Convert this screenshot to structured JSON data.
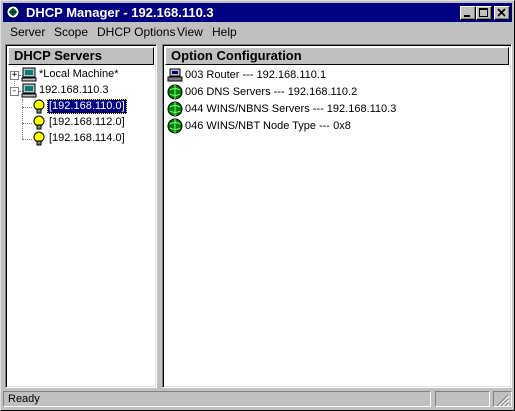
{
  "window": {
    "title": "DHCP Manager - 192.168.110.3"
  },
  "menu": [
    "Server",
    "Scope",
    "DHCP Options",
    "View",
    "Help"
  ],
  "left_panel": {
    "header": "DHCP Servers",
    "tree": [
      {
        "label": "*Local Machine*",
        "level": 0,
        "expander": "+",
        "icon": "server-icon"
      },
      {
        "label": "192.168.110.3",
        "level": 0,
        "expander": "-",
        "icon": "server-icon"
      },
      {
        "label": "[192.168.110.0]",
        "level": 1,
        "selected": true,
        "icon": "lightbulb-icon"
      },
      {
        "label": "[192.168.112.0]",
        "level": 1,
        "icon": "lightbulb-icon"
      },
      {
        "label": "[192.168.114.0]",
        "level": 1,
        "icon": "lightbulb-icon"
      }
    ]
  },
  "right_panel": {
    "header": "Option Configuration",
    "options": [
      {
        "text": "003 Router --- 192.168.110.1",
        "icon": "global-option-icon"
      },
      {
        "text": "006 DNS Servers --- 192.168.110.2",
        "icon": "scope-option-icon"
      },
      {
        "text": "044 WINS/NBNS Servers --- 192.168.110.3",
        "icon": "scope-option-icon"
      },
      {
        "text": "046 WINS/NBT Node Type --- 0x8",
        "icon": "scope-option-icon"
      }
    ]
  },
  "status": {
    "text": "Ready"
  },
  "colors": {
    "titlebar": "#000080",
    "face": "#c0c0c0",
    "selection": "#000080"
  }
}
